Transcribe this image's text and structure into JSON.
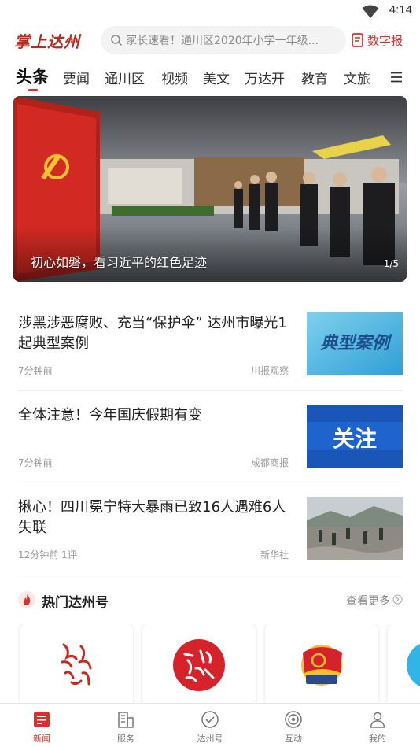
{
  "status_bar": {
    "time": "4:14"
  },
  "header": {
    "logo_text": "掌上达州",
    "search_placeholder": "家长速看！通川区2020年小学一年级...",
    "epaper_label": "数字报"
  },
  "tabs": [
    {
      "label": "头条",
      "active": true
    },
    {
      "label": "要闻"
    },
    {
      "label": "通川区"
    },
    {
      "label": "视频"
    },
    {
      "label": "美文"
    },
    {
      "label": "万达开"
    },
    {
      "label": "教育"
    },
    {
      "label": "文旅"
    }
  ],
  "banner": {
    "caption": "初心如磐，看习近平的红色足迹",
    "counter": "1/5"
  },
  "news": [
    {
      "title": "涉黑涉恶腐败、充当“保护伞” 达州市曝光1起典型案例",
      "time": "7分钟前",
      "comments": "",
      "source": "川报观察",
      "thumb_text": "典型案例"
    },
    {
      "title": "全体注意！今年国庆假期有变",
      "time": "7分钟前",
      "comments": "",
      "source": "成都商报",
      "thumb_text": "关注"
    },
    {
      "title": "揪心！四川冕宁特大暴雨已致16人遇难6人失联",
      "time": "12分钟前",
      "comments": "1评",
      "source": "新华社",
      "thumb_text": ""
    }
  ],
  "hot_section": {
    "title": "热门达州号",
    "more_label": "查看更多"
  },
  "bottom_nav": [
    {
      "label": "新闻",
      "active": true
    },
    {
      "label": "服务"
    },
    {
      "label": "达州号"
    },
    {
      "label": "互动"
    },
    {
      "label": "我的"
    }
  ],
  "colors": {
    "accent": "#d0342c",
    "text": "#222222",
    "meta": "#999999"
  }
}
